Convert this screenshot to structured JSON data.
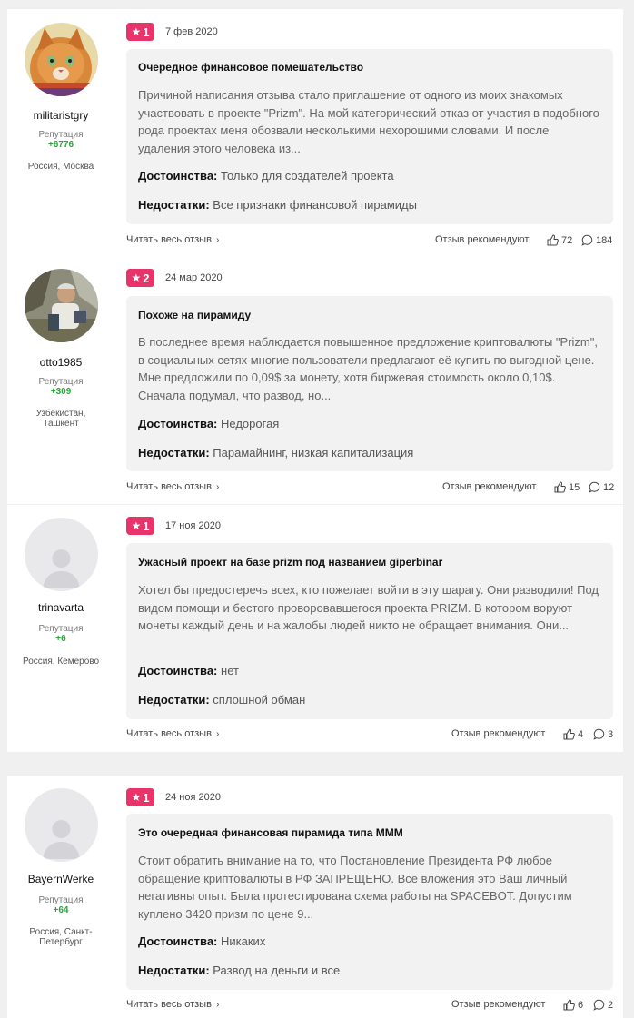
{
  "ui": {
    "rep_label": "Репутация",
    "pro_label": "Достоинства:",
    "con_label": "Недостатки:",
    "read_more": "Читать весь отзыв",
    "recommend": "Отзыв рекомендуют",
    "chevron": "›"
  },
  "reviews": [
    {
      "username": "militaristgry",
      "reputation": "+6776",
      "location": "Россия, Москва",
      "rating": "1",
      "date": "7 фев 2020",
      "title": "Очередное финансовое помешательство",
      "text": "Причиной написания отзыва стало приглашение от одного из моих знакомых участвовать в проекте \"Prizm\". На мой категорический отказ от участия в подобного рода проектах меня обозвали несколькими нехорошими словами. И после удаления этого человека из...",
      "pros": "Только для создателей проекта",
      "cons": "Все признаки финансовой пирамиды",
      "likes": "72",
      "comments": "184",
      "avatar": "cat-avatar"
    },
    {
      "username": "otto1985",
      "reputation": "+309",
      "location": "Узбекистан, Ташкент",
      "rating": "2",
      "date": "24 мар 2020",
      "title": "Похоже на пирамиду",
      "text": "В последнее время наблюдается повышенное предложение криптовалюты \"Prizm\", в социальных сетях многие пользователи предлагают её купить по выгодной цене. Мне предложили по 0,09$ за монету, хотя биржевая стоимость около 0,10$. Сначала подумал, что развод, но...",
      "pros": "Недорогая",
      "cons": "Парамайнинг, низкая капитализация",
      "likes": "15",
      "comments": "12",
      "avatar": "photo-avatar"
    },
    {
      "username": "trinavarta",
      "reputation": "+6",
      "location": "Россия, Кемерово",
      "rating": "1",
      "date": "17 ноя 2020",
      "title": "Ужасный проект на базе prizm под названием giperbinar",
      "text": "Хотел бы предостеречь всех, кто пожелает войти в эту шарагу. Они разводили! Под видом помощи и бестого проворовавшегося проекта PRIZM. В котором воруют монеты каждый день и на жалобы людей никто не обращает внимания. Они...",
      "pros": "нет",
      "cons": "сплошной обман",
      "likes": "4",
      "comments": "3",
      "avatar": "default-avatar"
    },
    {
      "username": "BayernWerke",
      "reputation": "+64",
      "location": "Россия, Санкт-Петербург",
      "rating": "1",
      "date": "24 ноя 2020",
      "title": "Это очередная финансовая пирамида типа МММ",
      "text": "Стоит обратить внимание на то, что Постановление Президента РФ любое обращение криптовалюты в РФ ЗАПРЕЩЕНО. Все вложения это Ваш личный негативны опыт. Была протестирована схема работы на SPACEBOT. Допустим куплено 3420 призм по цене 9...",
      "pros": "Никаких",
      "cons": "Развод на деньги и все",
      "likes": "6",
      "comments": "2",
      "avatar": "default-avatar"
    }
  ],
  "colors": {
    "badge": "#e8336b",
    "reputation": "#2aa63a",
    "box": "#f2f2f2"
  }
}
